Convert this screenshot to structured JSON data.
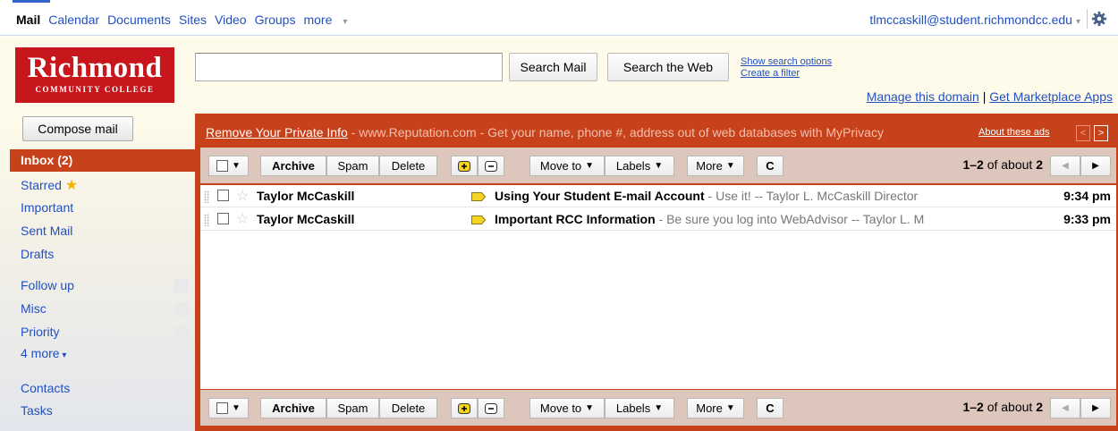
{
  "topnav": {
    "items": [
      "Mail",
      "Calendar",
      "Documents",
      "Sites",
      "Video",
      "Groups"
    ],
    "more": "more",
    "account": "tlmccaskill@student.richmondcc.edu"
  },
  "logo": {
    "name": "Richmond",
    "sub": "COMMUNITY COLLEGE"
  },
  "search": {
    "value": "",
    "search_mail": "Search Mail",
    "search_web": "Search the Web",
    "show_options": "Show search options",
    "create_filter": "Create a filter",
    "manage_domain": "Manage this domain",
    "separator": "|",
    "marketplace": "Get Marketplace Apps"
  },
  "sidebar": {
    "compose": "Compose mail",
    "inbox": "Inbox (2)",
    "starred": "Starred",
    "important": "Important",
    "sent": "Sent Mail",
    "drafts": "Drafts",
    "labels": [
      "Follow up",
      "Misc",
      "Priority"
    ],
    "more_labels": "4 more",
    "contacts": "Contacts",
    "tasks": "Tasks"
  },
  "ad": {
    "link": "Remove Your Private Info",
    "text": " - www.Reputation.com - Get your name, phone #, address out of web databases with MyPrivacy",
    "about": "About these ads"
  },
  "toolbar": {
    "archive": "Archive",
    "spam": "Spam",
    "delete": "Delete",
    "move_to": "Move to",
    "labels": "Labels",
    "more": "More",
    "range": "1–2",
    "of_about": "of about",
    "total": "2"
  },
  "messages": [
    {
      "sender": "Taylor McCaskill",
      "subject": "Using Your Student E-mail Account",
      "snippet": " - Use it! -- Taylor L. McCaskill Director",
      "time": "9:34 pm"
    },
    {
      "sender": "Taylor McCaskill",
      "subject": "Important RCC Information",
      "snippet": " - Be sure you log into WebAdvisor -- Taylor L. M",
      "time": "9:33 pm"
    }
  ],
  "colors": {
    "accent": "#c7411b",
    "header_bg": "#fffbea",
    "link": "#2050c0",
    "logo_red": "#c8161d"
  }
}
